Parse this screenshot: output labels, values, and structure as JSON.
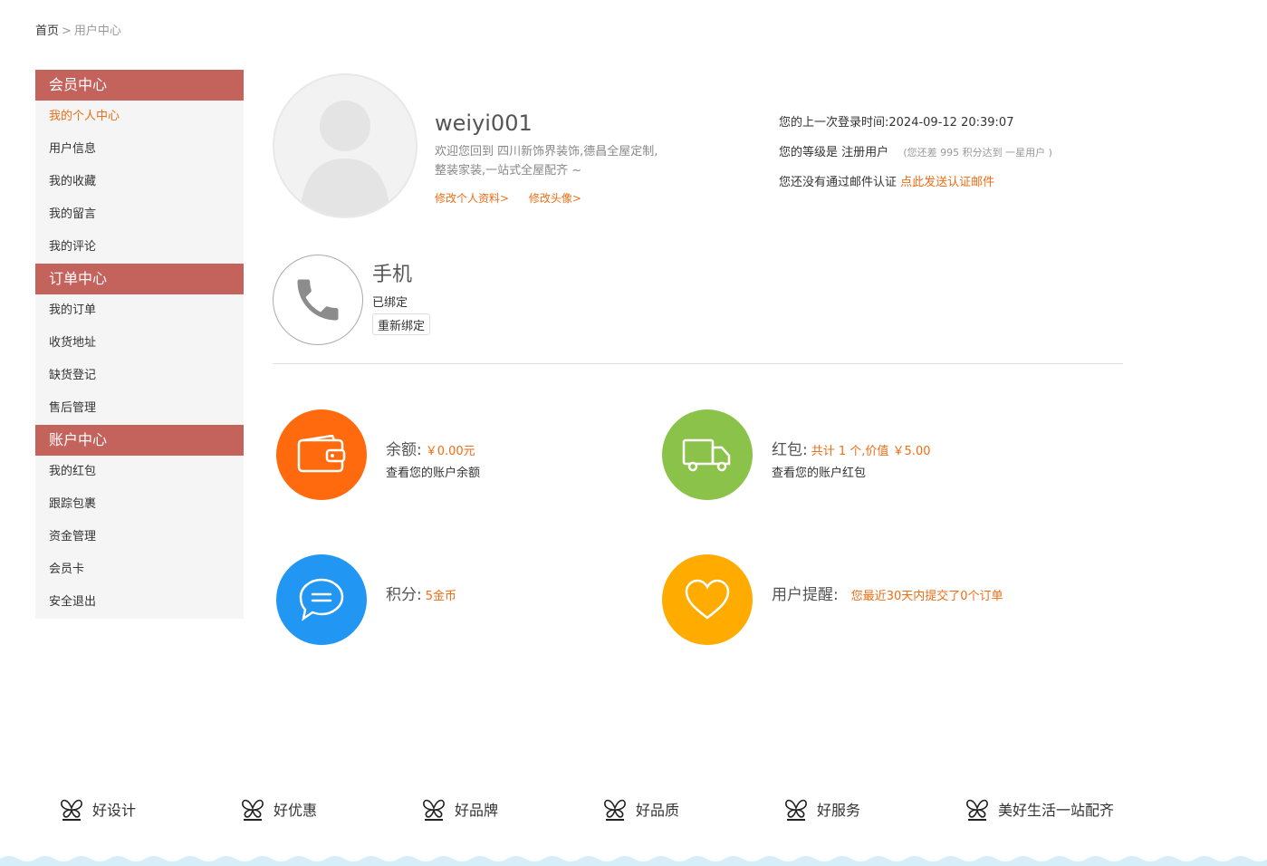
{
  "breadcrumb": {
    "home": "首页",
    "separator": ">",
    "current": "用户中心"
  },
  "sidebar": {
    "sections": [
      {
        "title": "会员中心",
        "items": [
          "我的个人中心",
          "用户信息",
          "我的收藏",
          "我的留言",
          "我的评论"
        ]
      },
      {
        "title": "订单中心",
        "items": [
          "我的订单",
          "收货地址",
          "缺货登记",
          "售后管理"
        ]
      },
      {
        "title": "账户中心",
        "items": [
          "我的红包",
          "跟踪包裹",
          "资金管理",
          "会员卡",
          "安全退出"
        ]
      }
    ],
    "active_item": "我的个人中心"
  },
  "profile": {
    "username": "weiyi001",
    "welcome": "欢迎您回到 四川新饰界装饰,德昌全屋定制,整装家装,一站式全屋配齐 ~",
    "edit_profile_link": "修改个人资料>",
    "edit_avatar_link": "修改头像>"
  },
  "login_info": {
    "last_login_label": "您的上一次登录时间:",
    "last_login_value": "2024-09-12 20:39:07",
    "level_label": "您的等级是",
    "level_value": "注册用户",
    "level_hint": "(您还差 995 积分达到 一星用户 )",
    "email_text": "您还没有通过邮件认证",
    "email_link": "点此发送认证邮件"
  },
  "phone": {
    "title": "手机",
    "status": "已绑定",
    "rebind_button": "重新绑定"
  },
  "stats": {
    "balance": {
      "label": "余额:",
      "value": "￥0.00元",
      "sub": "查看您的账户余额",
      "color": "#ff6a0e",
      "icon": "wallet-icon"
    },
    "bonus": {
      "label": "红包:",
      "value": "共计 1 个,价值 ￥5.00",
      "sub": "查看您的账户红包",
      "color": "#8bc34a",
      "icon": "truck-icon"
    },
    "points": {
      "label": "积分:",
      "value": "5金币",
      "color": "#2196f3",
      "icon": "chat-icon"
    },
    "reminder": {
      "label": "用户提醒:",
      "value": "您最近30天内提交了0个订单",
      "color": "#ffab00",
      "icon": "heart-icon"
    }
  },
  "features": [
    "好设计",
    "好优惠",
    "好品牌",
    "好品质",
    "好服务",
    "美好生活一站配齐"
  ],
  "colors": {
    "accent": "#ee6d15",
    "sidebar_header": "#c4625c",
    "sidebar_bg": "#f5f5f5"
  }
}
